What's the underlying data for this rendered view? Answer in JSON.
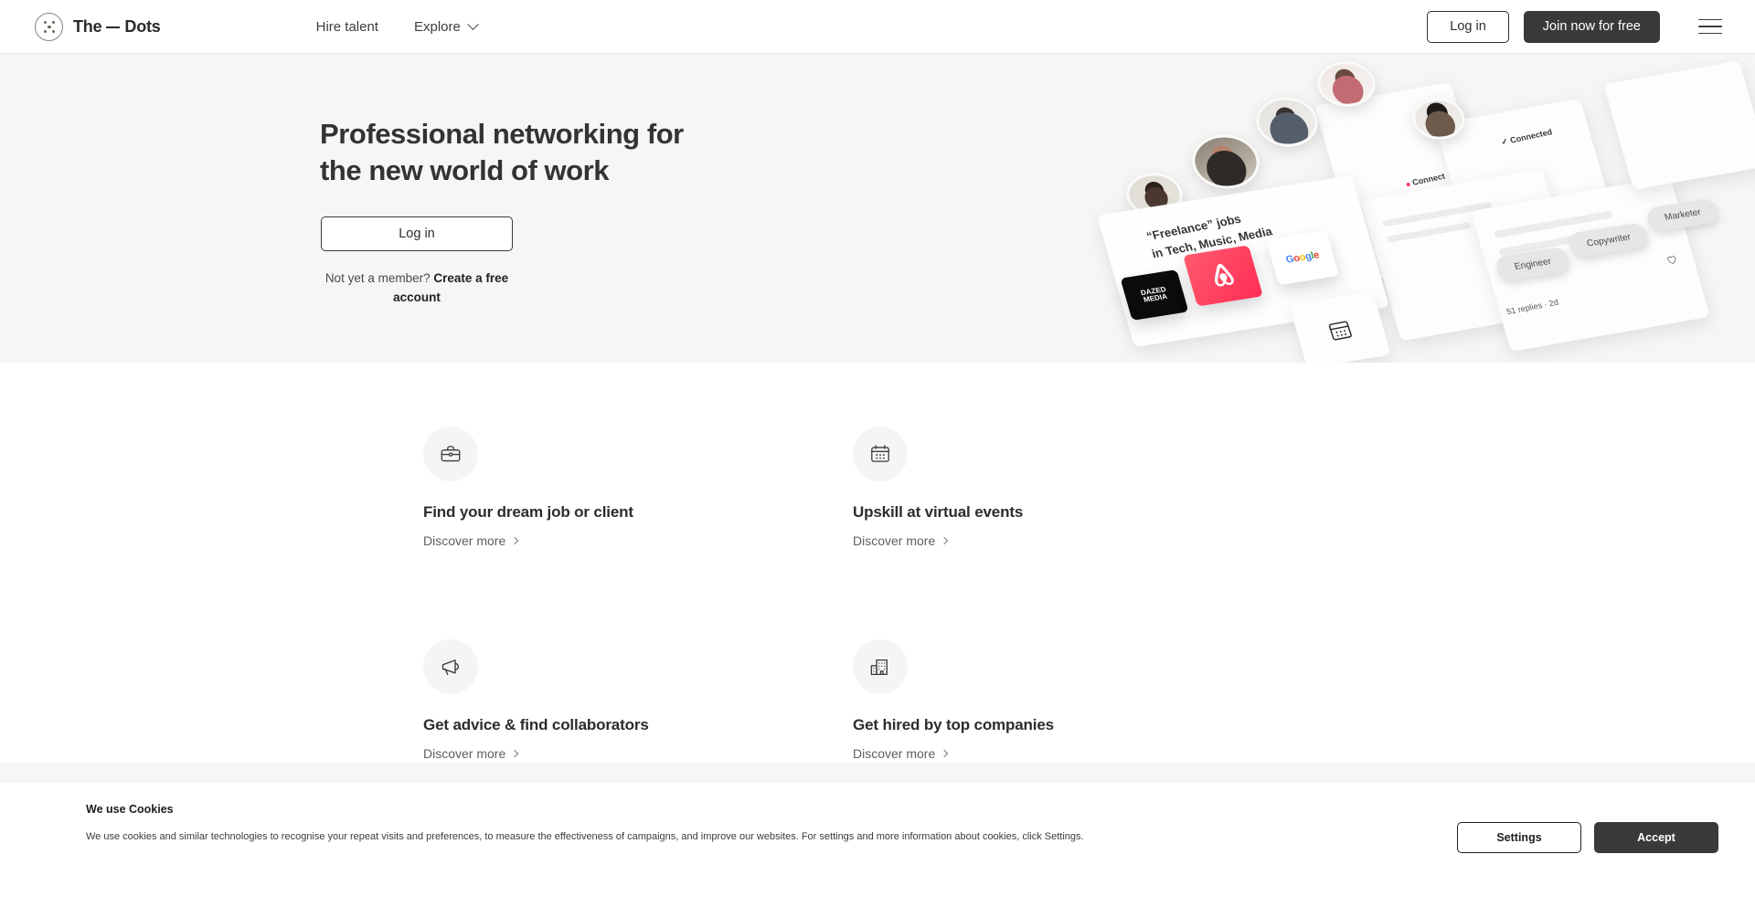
{
  "brand": {
    "name_left": "The",
    "name_right": "Dots",
    "logo_icon": "five-dots-circle-logo"
  },
  "nav": {
    "links": [
      {
        "label": "Hire talent",
        "icon": ""
      },
      {
        "label": "Explore",
        "icon": "chevron-down-icon"
      }
    ],
    "login_label": "Log in",
    "join_label": "Join now for free",
    "menu_icon": "hamburger-menu-icon"
  },
  "hero": {
    "title": "Professional networking for\nthe new world of work",
    "login_label": "Log in",
    "subtext_prefix": "Not yet a member? ",
    "subtext_link": "Create a free account",
    "illustration": {
      "headline": "“Freelance” jobs\nin Tech, Music, Media",
      "chips": [
        "Engineer",
        "Copywriter",
        "Marketer"
      ],
      "connect_label": "Connect",
      "connected_label": "✓ Connected",
      "replies_label": "51 replies · 2d",
      "brand_tiles": [
        {
          "name": "Dazed Media",
          "text": "DAZED\nMEDIA",
          "color": "#0b0b0b"
        },
        {
          "name": "Airbnb",
          "text": "",
          "color": "#ff385c"
        },
        {
          "name": "Google",
          "text": "Google",
          "color": "#ffffff"
        }
      ],
      "heart_icon": "heart-outline-icon",
      "calendar_icon": "calendar-icon"
    }
  },
  "features": [
    {
      "icon": "briefcase-icon",
      "title": "Find your dream job or client",
      "link_label": "Discover more"
    },
    {
      "icon": "calendar-icon",
      "title": "Upskill at virtual events",
      "link_label": "Discover more"
    },
    {
      "icon": "megaphone-icon",
      "title": "Get advice & find collaborators",
      "link_label": "Discover more"
    },
    {
      "icon": "office-building-icon",
      "title": "Get hired by top companies",
      "link_label": "Discover more"
    }
  ],
  "cookie_banner": {
    "title": "We use Cookies",
    "body": "We use cookies and similar technologies to recognise your repeat visits and preferences, to measure the effectiveness of campaigns, and improve our websites. For settings and more information about cookies, click Settings.",
    "settings_label": "Settings",
    "accept_label": "Accept"
  },
  "colors": {
    "dark": "#393939",
    "hero_bg": "#f6f6f5",
    "page_bg": "#ffffff",
    "accent_pink": "#ff385c",
    "link_blue": "#2457c5"
  }
}
